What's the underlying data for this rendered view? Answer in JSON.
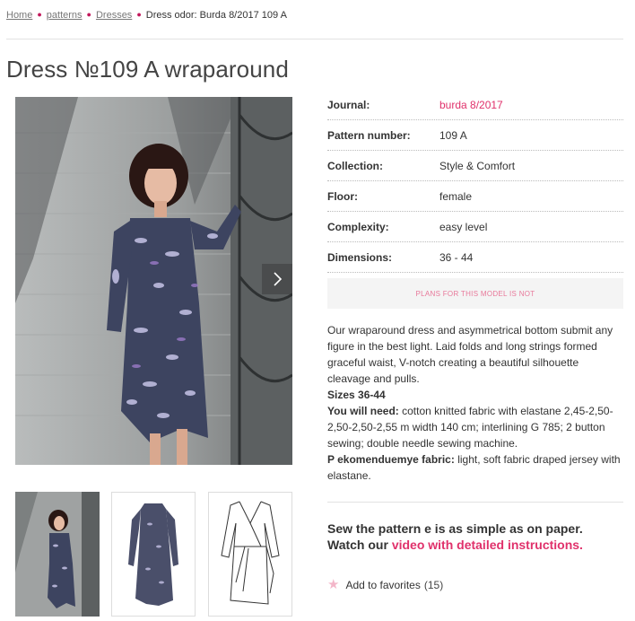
{
  "breadcrumb": {
    "home": "Home",
    "patterns": "patterns",
    "dresses": "Dresses",
    "current": "Dress odor: Burda 8/2017 109 A"
  },
  "title": "Dress №109 A wraparound",
  "specs": [
    {
      "label": "Journal:",
      "value": "burda 8/2017"
    },
    {
      "label": "Pattern number:",
      "value": "109 A"
    },
    {
      "label": "Collection:",
      "value": "Style & Comfort"
    },
    {
      "label": "Floor:",
      "value": "female"
    },
    {
      "label": "Complexity:",
      "value": "easy level"
    },
    {
      "label": "Dimensions:",
      "value": "36 - 44"
    }
  ],
  "plans_notice": "PLANS FOR THIS MODEL IS NOT",
  "description": {
    "intro": "Our wraparound dress and asymmetrical bottom submit any figure in the best light. Laid folds and long strings formed graceful waist, V-notch creating a beautiful silhouette cleavage and pulls.",
    "sizes": "Sizes 36-44",
    "need_label": "You will need:",
    "need_text": "cotton knitted fabric with elastane 2,45-2,50-2,50-2,50-2,55 m width 140 cm; interlining G 785; 2 button sewing; double needle sewing machine.",
    "fabric_label": "P ekomenduemye fabric:",
    "fabric_text": "light, soft fabric draped jersey with elastane."
  },
  "promo": {
    "line1": "Sew the pattern e is as simple as on paper.",
    "line2_prefix": "Watch our",
    "link": "video with detailed instructions."
  },
  "favorites": {
    "label": "Add to favorites",
    "count": "(15)"
  },
  "colors": {
    "accent": "#e0316b",
    "breadcrumb_dot": "#c2185b",
    "star": "#f3b6c9"
  }
}
